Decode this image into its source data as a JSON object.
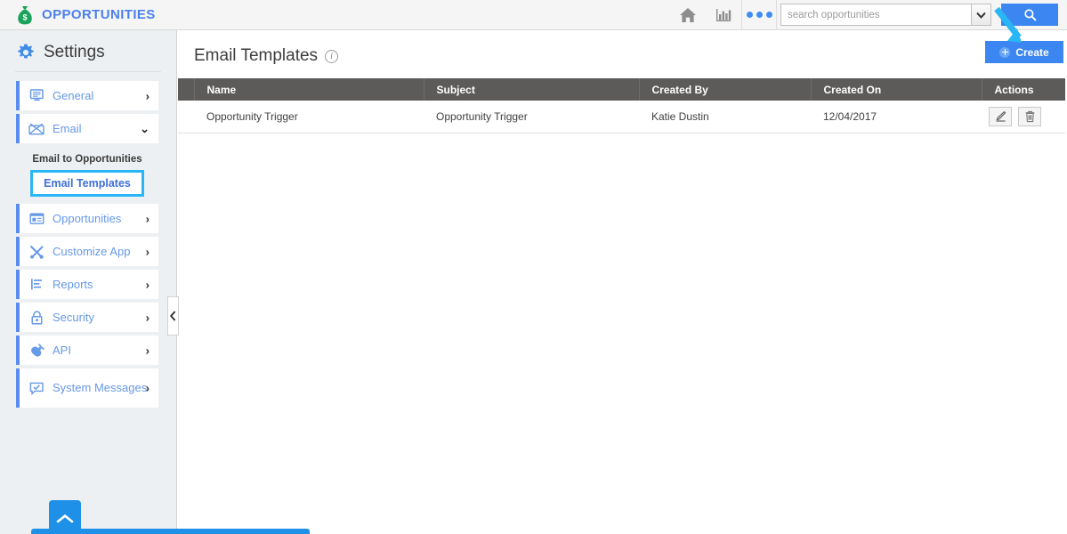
{
  "topbar": {
    "brand_label": "OPPORTUNITIES",
    "brand_icon": "money-bag-icon",
    "home_icon": "home-icon",
    "reports_icon": "bar-chart-icon",
    "more_icon": "more-dots-icon",
    "search_placeholder": "search opportunities",
    "search_value": "",
    "search_caret_icon": "chevron-down-icon",
    "search_button_icon": "search-icon"
  },
  "sidebar": {
    "title": "Settings",
    "gear_icon": "gear-icon",
    "items": [
      {
        "label": "General",
        "icon": "monitor-icon",
        "chevron": "›"
      },
      {
        "label": "Email",
        "icon": "envelope-icon",
        "chevron": "⌄"
      },
      {
        "label": "Opportunities",
        "icon": "window-icon",
        "chevron": "›"
      },
      {
        "label": "Customize App",
        "icon": "tools-icon",
        "chevron": "›"
      },
      {
        "label": "Reports",
        "icon": "chart-icon",
        "chevron": "›"
      },
      {
        "label": "Security",
        "icon": "lock-icon",
        "chevron": "›"
      },
      {
        "label": "API",
        "icon": "plug-icon",
        "chevron": "›"
      },
      {
        "label": "System Messages",
        "icon": "message-check-icon",
        "chevron": "›"
      }
    ],
    "email_subhead": "Email to Opportunities",
    "email_subitem": "Email Templates",
    "collapse_icon": "chevron-left-icon",
    "scroll_top_icon": "chevron-up-icon"
  },
  "main": {
    "page_title": "Email Templates",
    "info_icon": "info-icon",
    "create_label": "Create",
    "create_icon": "plus-circle-icon",
    "table": {
      "columns": [
        "Name",
        "Subject",
        "Created By",
        "Created On",
        "Actions"
      ],
      "rows": [
        {
          "name": "Opportunity Trigger",
          "subject": "Opportunity Trigger",
          "created_by": "Katie Dustin",
          "created_on": "12/04/2017",
          "edit_icon": "pencil-icon",
          "delete_icon": "trash-icon"
        }
      ]
    }
  },
  "annotation": {
    "arrow_icon": "highlight-arrow-icon",
    "arrow_color": "#29b6f6",
    "highlight_color": "#29b6f6"
  },
  "colors": {
    "brand_blue": "#4a80ee",
    "accent_blue": "#3b86f0",
    "sidebar_bg": "#edf0f2",
    "table_header": "#5d5b5a",
    "link_blue": "#6699e6"
  }
}
